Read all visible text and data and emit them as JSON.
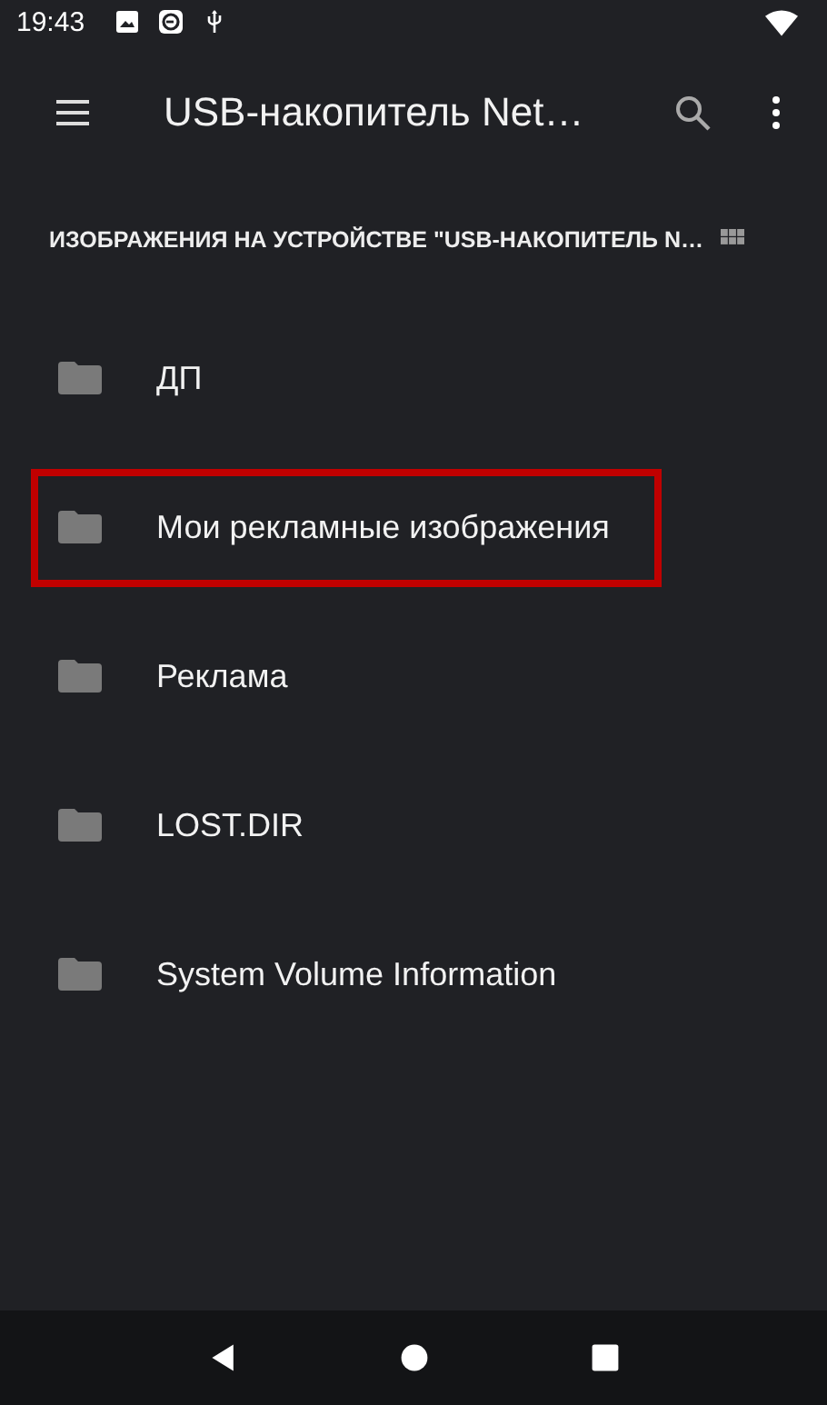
{
  "status_bar": {
    "time": "19:43"
  },
  "toolbar": {
    "title": "USB-накопитель Net…"
  },
  "header": {
    "label": "ИЗОБРАЖЕНИЯ НА УСТРОЙСТВЕ \"USB-НАКОПИТЕЛЬ N…"
  },
  "folders": [
    {
      "name": "ДП",
      "highlighted": false
    },
    {
      "name": "Мои рекламные изображения",
      "highlighted": true
    },
    {
      "name": "Реклама",
      "highlighted": false
    },
    {
      "name": "LOST.DIR",
      "highlighted": false
    },
    {
      "name": "System Volume Information",
      "highlighted": false
    }
  ]
}
